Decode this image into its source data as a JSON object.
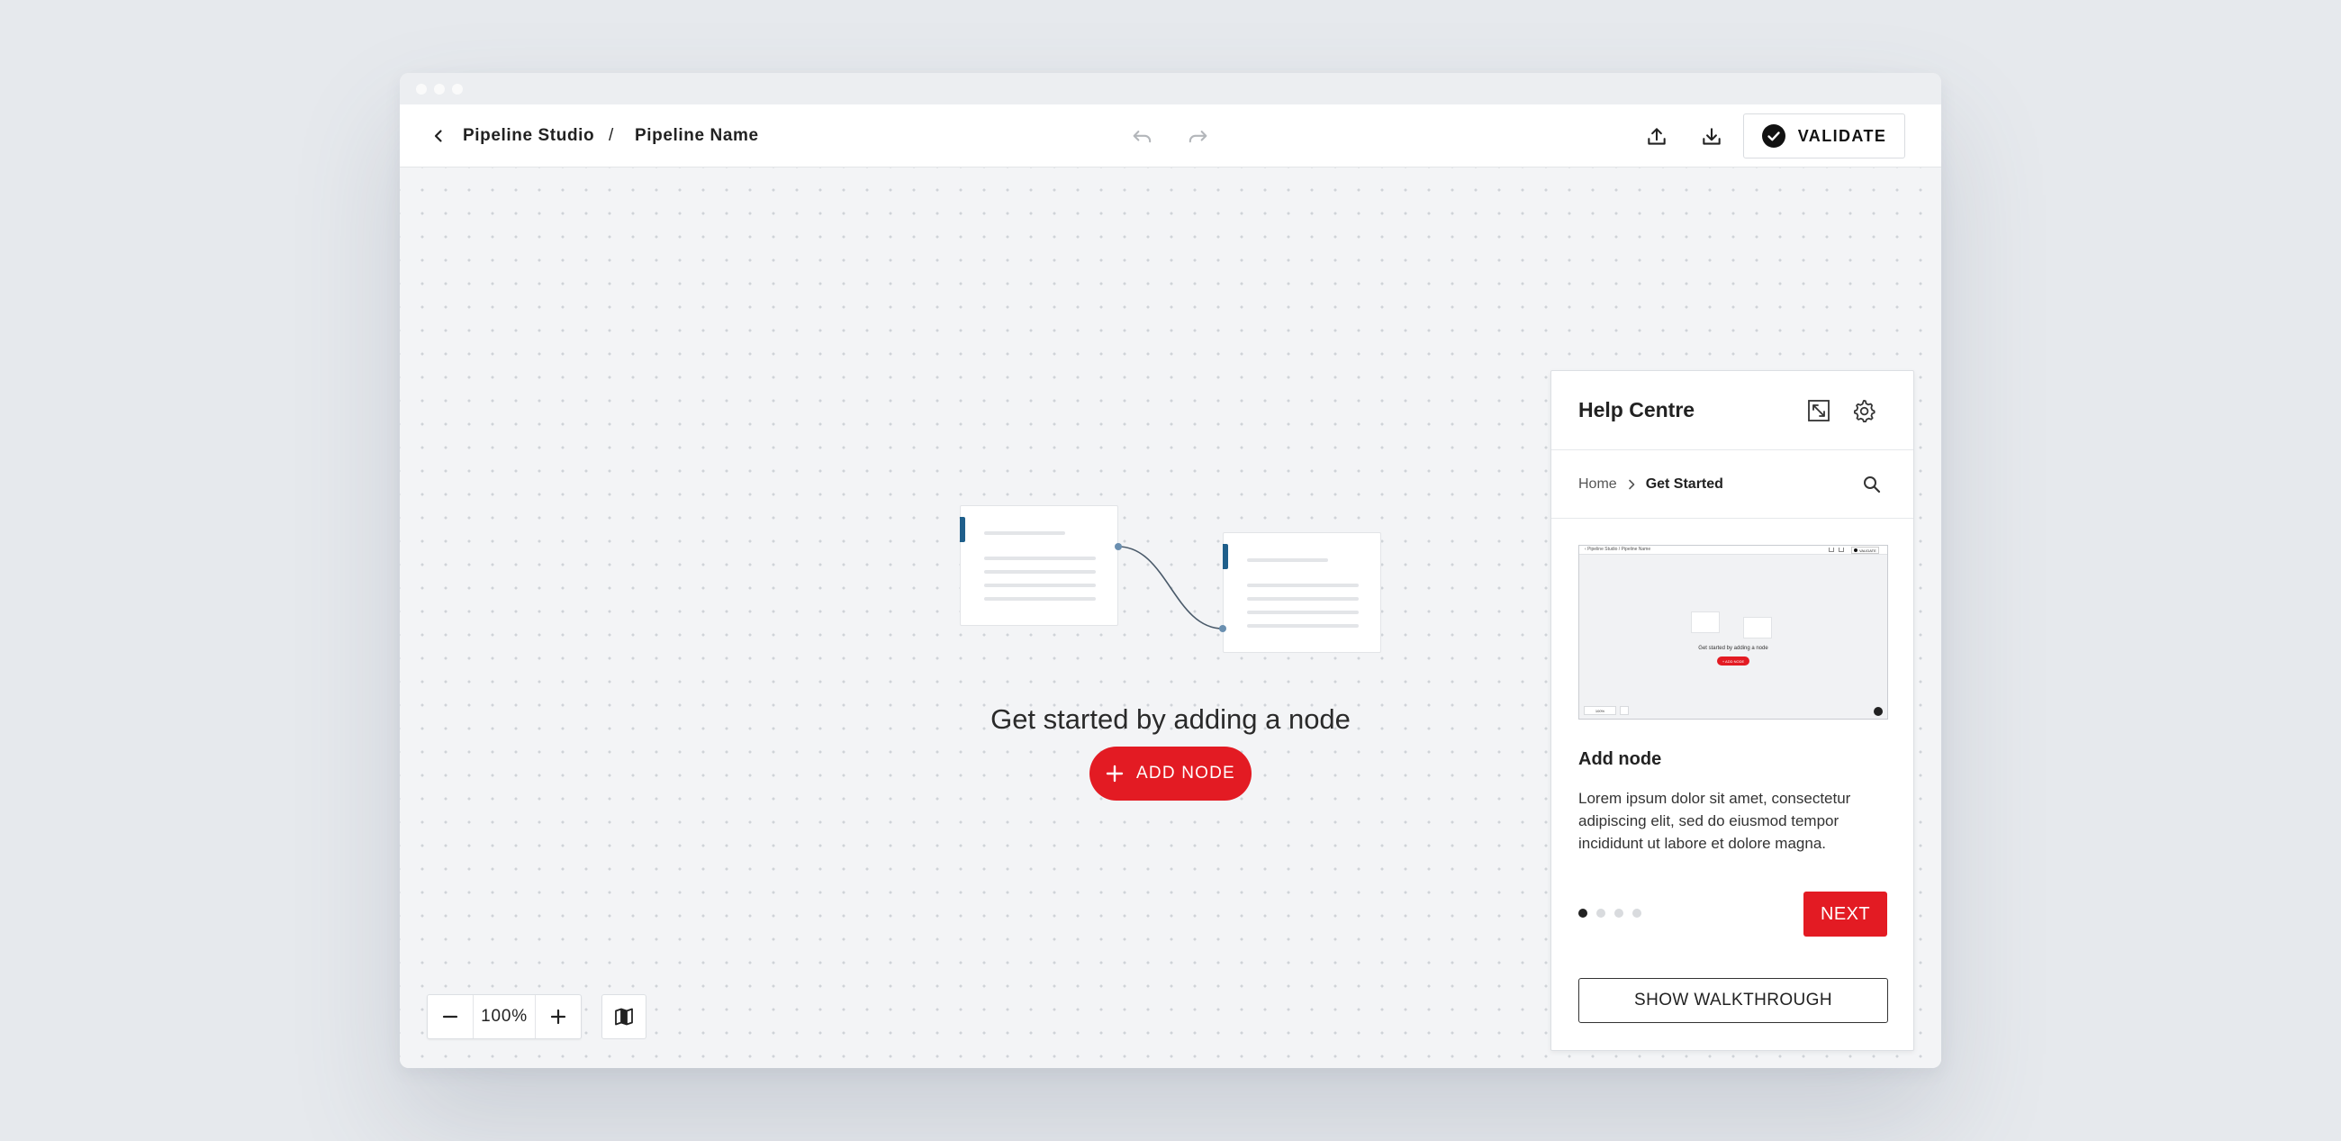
{
  "toolbar": {
    "back_icon": "chevron-left-icon",
    "app_name": "Pipeline Studio",
    "separator": "/",
    "pipeline_name": "Pipeline Name",
    "undo_icon": "undo-icon",
    "redo_icon": "redo-icon",
    "upload_icon": "upload-icon",
    "download_icon": "download-icon",
    "validate_label": "VALIDATE"
  },
  "canvas": {
    "empty_title": "Get started by adding a node",
    "add_node_label": "ADD NODE"
  },
  "zoom": {
    "level": "100%",
    "zoom_out_icon": "minus-icon",
    "zoom_in_icon": "plus-icon",
    "minimap_icon": "map-icon"
  },
  "help": {
    "title": "Help Centre",
    "breadcrumb_home": "Home",
    "breadcrumb_current": "Get Started",
    "step_title": "Add node",
    "step_body": "Lorem ipsum dolor sit amet, consectetur adipiscing elit, sed do eiusmod tempor incididunt ut labore et dolore magna.",
    "preview": {
      "app_name": "Pipeline Studio",
      "pipeline_name": "Pipeline Name",
      "validate_label": "VALIDATE",
      "empty_title": "Get started by adding a node",
      "add_node_label": "+ ADD NODE",
      "zoom_level": "100%"
    },
    "steps_total": 4,
    "step_index": 1,
    "next_label": "NEXT",
    "walkthrough_label": "SHOW WALKTHROUGH"
  },
  "colors": {
    "accent_red": "#e31b23",
    "node_tab_blue": "#1f5f8b"
  }
}
